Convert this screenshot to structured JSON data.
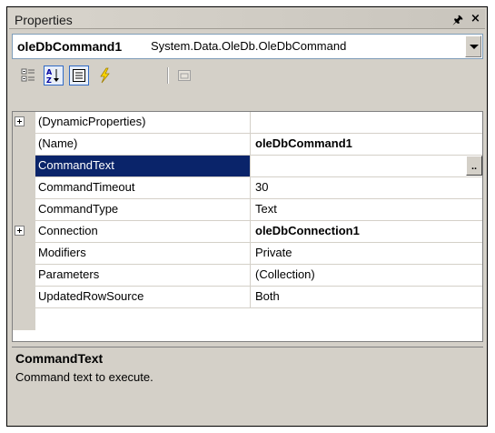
{
  "window": {
    "title": "Properties",
    "pin_icon": "pin-icon",
    "close_icon": "close-icon"
  },
  "selector": {
    "object_name": "oleDbCommand1",
    "object_type": "System.Data.OleDb.OleDbCommand"
  },
  "toolbar": {
    "buttons": [
      {
        "name": "categorized-icon",
        "pressed": false
      },
      {
        "name": "alphabetical-icon",
        "pressed": true
      },
      {
        "name": "properties-icon",
        "pressed": true
      },
      {
        "name": "events-icon",
        "pressed": false
      },
      {
        "name": "property-pages-icon",
        "pressed": false
      }
    ]
  },
  "properties": [
    {
      "name": "(DynamicProperties)",
      "value": "",
      "expandable": true,
      "bold": false
    },
    {
      "name": "(Name)",
      "value": "oleDbCommand1",
      "expandable": false,
      "bold": true
    },
    {
      "name": "CommandText",
      "value": "",
      "expandable": false,
      "bold": false,
      "selected": true,
      "ellipsis": ".."
    },
    {
      "name": "CommandTimeout",
      "value": "30",
      "expandable": false,
      "bold": false
    },
    {
      "name": "CommandType",
      "value": "Text",
      "expandable": false,
      "bold": false
    },
    {
      "name": "Connection",
      "value": "oleDbConnection1",
      "expandable": true,
      "bold": true
    },
    {
      "name": "Modifiers",
      "value": "Private",
      "expandable": false,
      "bold": false
    },
    {
      "name": "Parameters",
      "value": "(Collection)",
      "expandable": false,
      "bold": false
    },
    {
      "name": "UpdatedRowSource",
      "value": "Both",
      "expandable": false,
      "bold": false
    }
  ],
  "description": {
    "title": "CommandText",
    "text": "Command text to execute."
  },
  "colors": {
    "selection": "#0a246a",
    "panel": "#d4d0c8"
  }
}
